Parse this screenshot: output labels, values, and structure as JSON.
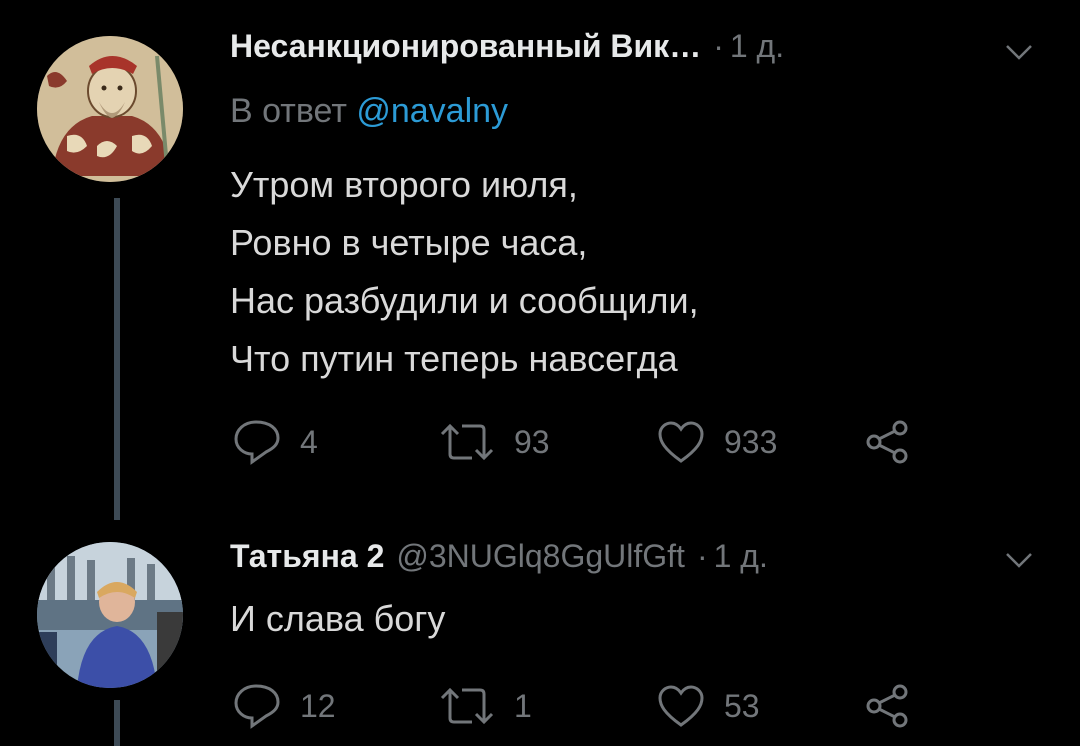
{
  "colors": {
    "background": "#000000",
    "text": "#d9d9d9",
    "secondary": "#72767a",
    "link": "#2c9bd6",
    "thread_line": "#3d4a55"
  },
  "tweets": [
    {
      "author_name": "Несанкционированный Вик…",
      "handle": "",
      "separator": "·",
      "time": "1 д.",
      "reply_prefix": "В ответ ",
      "reply_mention": "@navalny",
      "lines": [
        "Утром второго июля,",
        "Ровно в четыре часа,",
        "Нас разбудили и сообщили,",
        "Что путин теперь навсегда"
      ],
      "replies": "4",
      "retweets": "93",
      "likes": "933",
      "avatar_icon": "medieval-illustration-avatar"
    },
    {
      "author_name": "Татьяна 2",
      "handle": "@3NUGlq8GgUlfGft",
      "separator": "·",
      "time": "1 д.",
      "lines": [
        "И слава богу"
      ],
      "replies": "12",
      "retweets": "1",
      "likes": "53",
      "avatar_icon": "photo-avatar"
    }
  ]
}
